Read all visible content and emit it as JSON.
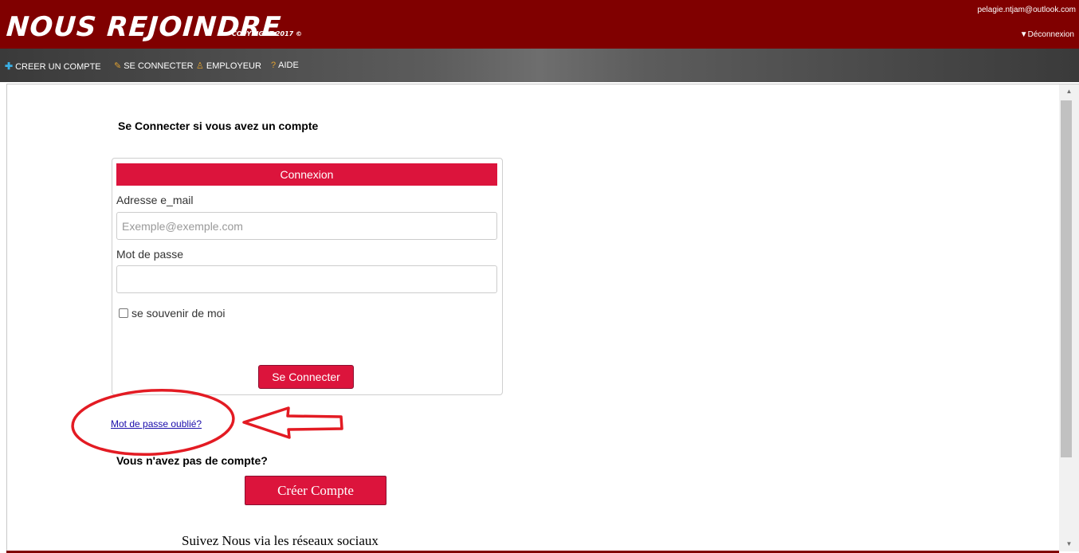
{
  "header": {
    "brand": "NOUS REJOINDRE",
    "copyright": "COPYRIGHT 2017 ©",
    "user_email": "pelagie.ntjam@outlook.com",
    "logout": "▼Déconnexion"
  },
  "nav": {
    "items": [
      {
        "icon": "plus-icon",
        "glyph": "✚",
        "label": "CREER UN COMPTE"
      },
      {
        "icon": "pencil-icon",
        "glyph": "✎",
        "label": "SE CONNECTER"
      },
      {
        "icon": "user-icon",
        "glyph": "♙",
        "label": "EMPLOYEUR"
      },
      {
        "icon": "question-icon",
        "glyph": "?",
        "label": "AIDE"
      }
    ]
  },
  "main": {
    "section_title": "Se Connecter si vous avez un compte",
    "login_panel": {
      "heading": "Connexion",
      "email_label": "Adresse e_mail",
      "email_placeholder": "Exemple@exemple.com",
      "email_value": "",
      "password_label": "Mot de passe",
      "password_value": "",
      "remember_label": "se souvenir de moi",
      "submit_label": "Se Connecter"
    },
    "forgot_password": "Mot de passe oublié?",
    "no_account": "Vous n'avez pas de compte?",
    "create_account": "Créer Compte",
    "follow_us": "Suivez Nous via les réseaux sociaux"
  },
  "colors": {
    "header_bg": "#800000",
    "accent": "#dc143c",
    "annotation": "#e31b23",
    "link": "#1a0dab"
  }
}
